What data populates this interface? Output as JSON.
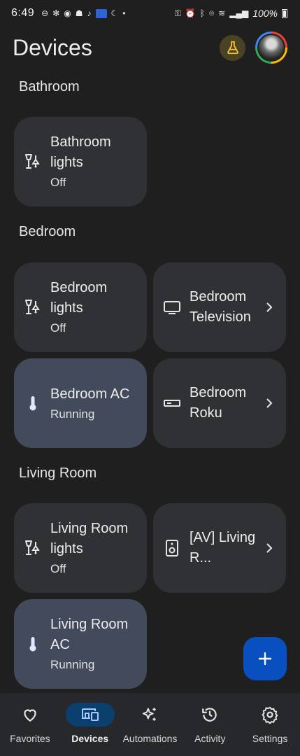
{
  "status_bar": {
    "time": "6:49",
    "battery": "100%"
  },
  "header": {
    "title": "Devices"
  },
  "sections": [
    {
      "title": "Bathroom",
      "devices": [
        {
          "name": "Bathroom lights",
          "status": "Off",
          "icon": "lamp-icon"
        }
      ]
    },
    {
      "title": "Bedroom",
      "devices": [
        {
          "name": "Bedroom lights",
          "status": "Off",
          "icon": "lamp-icon"
        },
        {
          "name": "Bedroom Television",
          "status": "",
          "icon": "tv-icon"
        },
        {
          "name": "Bedroom AC",
          "status": "Running",
          "icon": "thermometer-icon"
        },
        {
          "name": "Bedroom Roku",
          "status": "",
          "icon": "streaming-box-icon"
        }
      ]
    },
    {
      "title": "Living Room",
      "devices": [
        {
          "name": "Living Room lights",
          "status": "Off",
          "icon": "lamp-icon"
        },
        {
          "name": "[AV] Living R...",
          "status": "",
          "icon": "speaker-icon"
        },
        {
          "name": "Living Room AC",
          "status": "Running",
          "icon": "thermometer-icon"
        }
      ]
    }
  ],
  "nav": [
    {
      "label": "Favorites",
      "icon": "heart-icon"
    },
    {
      "label": "Devices",
      "icon": "devices-icon"
    },
    {
      "label": "Automations",
      "icon": "sparkle-icon"
    },
    {
      "label": "Activity",
      "icon": "history-icon"
    },
    {
      "label": "Settings",
      "icon": "gear-icon"
    }
  ],
  "colors": {
    "background": "#1f1f1f",
    "card": "#2f3135",
    "card_active": "#424a5b",
    "fab": "#0a4fbf",
    "nav_active": "#0b3f6e"
  }
}
